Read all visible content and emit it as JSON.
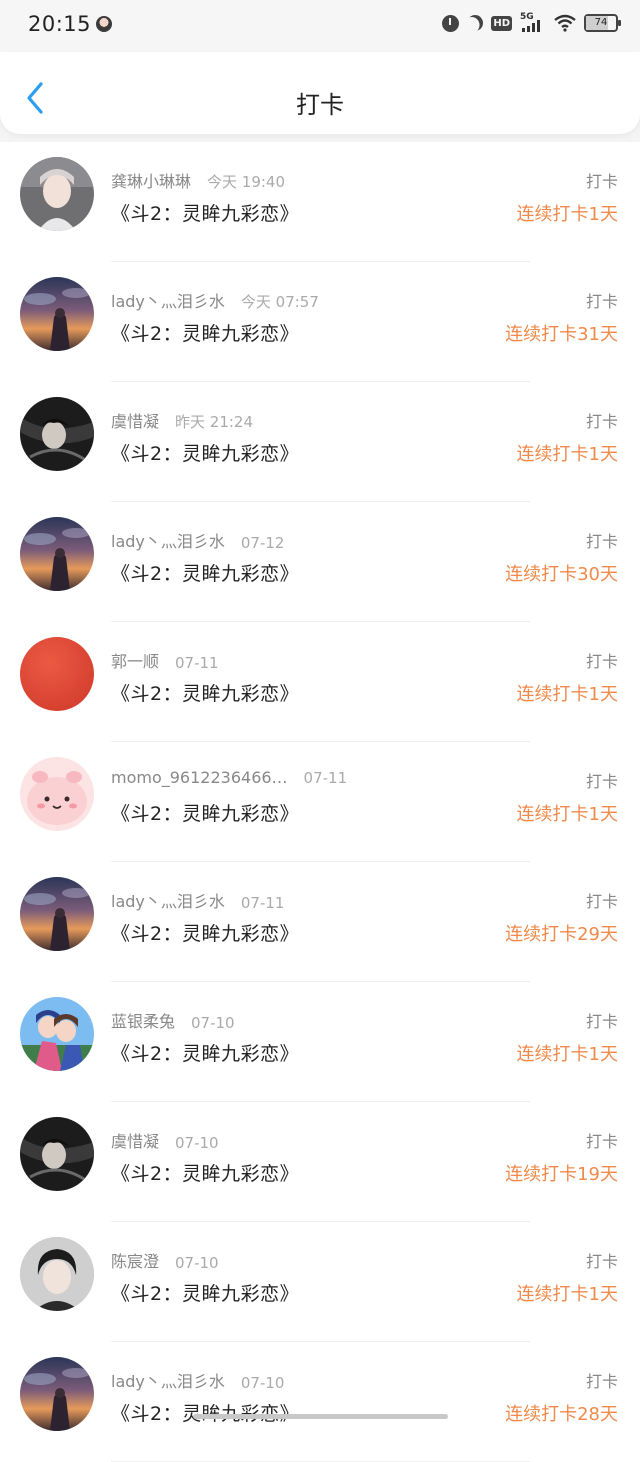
{
  "status_bar": {
    "time": "20:15",
    "battery": "74",
    "network": "5G",
    "hd": "HD"
  },
  "header": {
    "title": "打卡"
  },
  "items": [
    {
      "name": "龚琳小琳琳",
      "time": "今天 19:40",
      "work": "《斗2：灵眸九彩恋》",
      "type": "打卡",
      "streak": "连续打卡1天",
      "avatar": "portrait-light"
    },
    {
      "name": "lady丶灬泪彡水",
      "time": "今天 07:57",
      "work": "《斗2：灵眸九彩恋》",
      "type": "打卡",
      "streak": "连续打卡31天",
      "avatar": "sunset-couple"
    },
    {
      "name": "虞惜凝",
      "time": "昨天 21:24",
      "work": "《斗2：灵眸九彩恋》",
      "type": "打卡",
      "streak": "连续打卡1天",
      "avatar": "dark-art"
    },
    {
      "name": "lady丶灬泪彡水",
      "time": "07-12",
      "work": "《斗2：灵眸九彩恋》",
      "type": "打卡",
      "streak": "连续打卡30天",
      "avatar": "sunset-couple"
    },
    {
      "name": "郭一顺",
      "time": "07-11",
      "work": "《斗2：灵眸九彩恋》",
      "type": "打卡",
      "streak": "连续打卡1天",
      "avatar": "red-circle"
    },
    {
      "name": "momo_9612236466…",
      "time": "07-11",
      "work": "《斗2：灵眸九彩恋》",
      "type": "打卡",
      "streak": "连续打卡1天",
      "avatar": "pink-cute"
    },
    {
      "name": "lady丶灬泪彡水",
      "time": "07-11",
      "work": "《斗2：灵眸九彩恋》",
      "type": "打卡",
      "streak": "连续打卡29天",
      "avatar": "sunset-couple"
    },
    {
      "name": "蓝银柔兔",
      "time": "07-10",
      "work": "《斗2：灵眸九彩恋》",
      "type": "打卡",
      "streak": "连续打卡1天",
      "avatar": "anime-couple"
    },
    {
      "name": "虞惜凝",
      "time": "07-10",
      "work": "《斗2：灵眸九彩恋》",
      "type": "打卡",
      "streak": "连续打卡19天",
      "avatar": "dark-art"
    },
    {
      "name": "陈宸澄",
      "time": "07-10",
      "work": "《斗2：灵眸九彩恋》",
      "type": "打卡",
      "streak": "连续打卡1天",
      "avatar": "portrait-dark"
    },
    {
      "name": "lady丶灬泪彡水",
      "time": "07-10",
      "work": "《斗2：灵眸九彩恋》",
      "type": "打卡",
      "streak": "连续打卡28天",
      "avatar": "sunset-couple"
    }
  ],
  "colors": {
    "accent": "#f08a4b",
    "back_arrow": "#2a9df4"
  }
}
